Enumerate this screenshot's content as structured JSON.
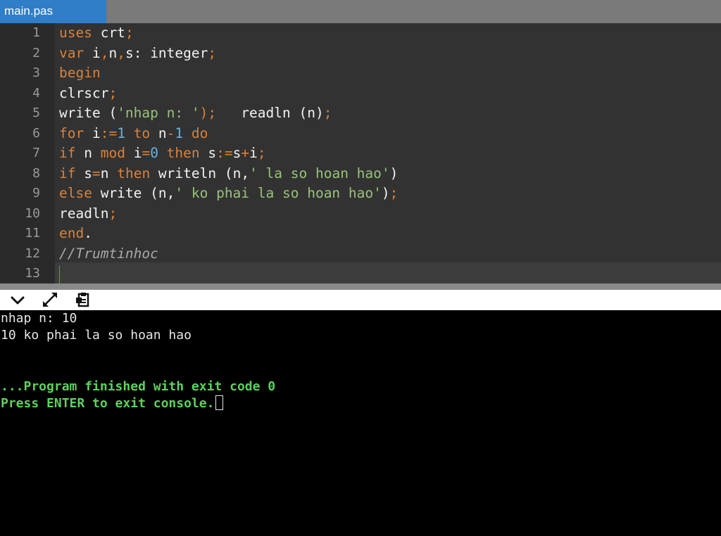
{
  "tab": {
    "title": "main.pas"
  },
  "editor": {
    "line_numbers": [
      "1",
      "2",
      "3",
      "4",
      "5",
      "6",
      "7",
      "8",
      "9",
      "10",
      "11",
      "12",
      "13"
    ],
    "lines": [
      [
        {
          "t": "uses ",
          "c": "kw"
        },
        {
          "t": "crt",
          "c": "id"
        },
        {
          "t": ";",
          "c": "op"
        }
      ],
      [
        {
          "t": "var ",
          "c": "kw"
        },
        {
          "t": "i",
          "c": "id"
        },
        {
          "t": ",",
          "c": "op"
        },
        {
          "t": "n",
          "c": "id"
        },
        {
          "t": ",",
          "c": "op"
        },
        {
          "t": "s: integer",
          "c": "id"
        },
        {
          "t": ";",
          "c": "op"
        }
      ],
      [
        {
          "t": "begin",
          "c": "kw"
        }
      ],
      [
        {
          "t": "clrscr",
          "c": "id"
        },
        {
          "t": ";",
          "c": "op"
        }
      ],
      [
        {
          "t": "write (",
          "c": "id"
        },
        {
          "t": "'nhap n: '",
          "c": "str"
        },
        {
          "t": ");",
          "c": "op"
        },
        {
          "t": "   readln (n)",
          "c": "id"
        },
        {
          "t": ";",
          "c": "op"
        }
      ],
      [
        {
          "t": "for ",
          "c": "kw"
        },
        {
          "t": "i",
          "c": "id"
        },
        {
          "t": ":=",
          "c": "op"
        },
        {
          "t": "1",
          "c": "num"
        },
        {
          "t": " to ",
          "c": "kw"
        },
        {
          "t": "n",
          "c": "id"
        },
        {
          "t": "-",
          "c": "op"
        },
        {
          "t": "1",
          "c": "num"
        },
        {
          "t": " do",
          "c": "kw"
        }
      ],
      [
        {
          "t": "if ",
          "c": "kw"
        },
        {
          "t": "n ",
          "c": "id"
        },
        {
          "t": "mod ",
          "c": "kw"
        },
        {
          "t": "i",
          "c": "id"
        },
        {
          "t": "=",
          "c": "op"
        },
        {
          "t": "0",
          "c": "num"
        },
        {
          "t": " then ",
          "c": "kw"
        },
        {
          "t": "s",
          "c": "id"
        },
        {
          "t": ":=",
          "c": "op"
        },
        {
          "t": "s",
          "c": "id"
        },
        {
          "t": "+",
          "c": "op"
        },
        {
          "t": "i",
          "c": "id"
        },
        {
          "t": ";",
          "c": "op"
        }
      ],
      [
        {
          "t": "if ",
          "c": "kw"
        },
        {
          "t": "s",
          "c": "id"
        },
        {
          "t": "=",
          "c": "op"
        },
        {
          "t": "n ",
          "c": "id"
        },
        {
          "t": "then ",
          "c": "kw"
        },
        {
          "t": "writeln (n,",
          "c": "id"
        },
        {
          "t": "' la so hoan hao'",
          "c": "str"
        },
        {
          "t": ")",
          "c": "id"
        }
      ],
      [
        {
          "t": "else ",
          "c": "kw"
        },
        {
          "t": "write (n,",
          "c": "id"
        },
        {
          "t": "' ko phai la so hoan hao'",
          "c": "str"
        },
        {
          "t": ")",
          "c": "id"
        },
        {
          "t": ";",
          "c": "op"
        }
      ],
      [
        {
          "t": "readln",
          "c": "id"
        },
        {
          "t": ";",
          "c": "op"
        }
      ],
      [
        {
          "t": "end",
          "c": "kw"
        },
        {
          "t": ".",
          "c": "id"
        }
      ],
      [
        {
          "t": "//Trumtinhoc",
          "c": "com"
        }
      ],
      []
    ]
  },
  "toolbar": {
    "buttons": [
      {
        "name": "collapse-button",
        "icon": "chevron-down-icon"
      },
      {
        "name": "expand-button",
        "icon": "expand-arrows-icon"
      },
      {
        "name": "copy-output-button",
        "icon": "clipboard-icon"
      }
    ]
  },
  "console": {
    "line1": "nhap n: 10",
    "line2": "10 ko phai la so hoan hao",
    "line3": "...Program finished with exit code 0",
    "line4": "Press ENTER to exit console."
  },
  "colors": {
    "keyword": "#d9823b",
    "string": "#98c379",
    "number": "#6cb0e0",
    "console_green": "#5dd15d",
    "tab_blue": "#2f7ec7"
  }
}
